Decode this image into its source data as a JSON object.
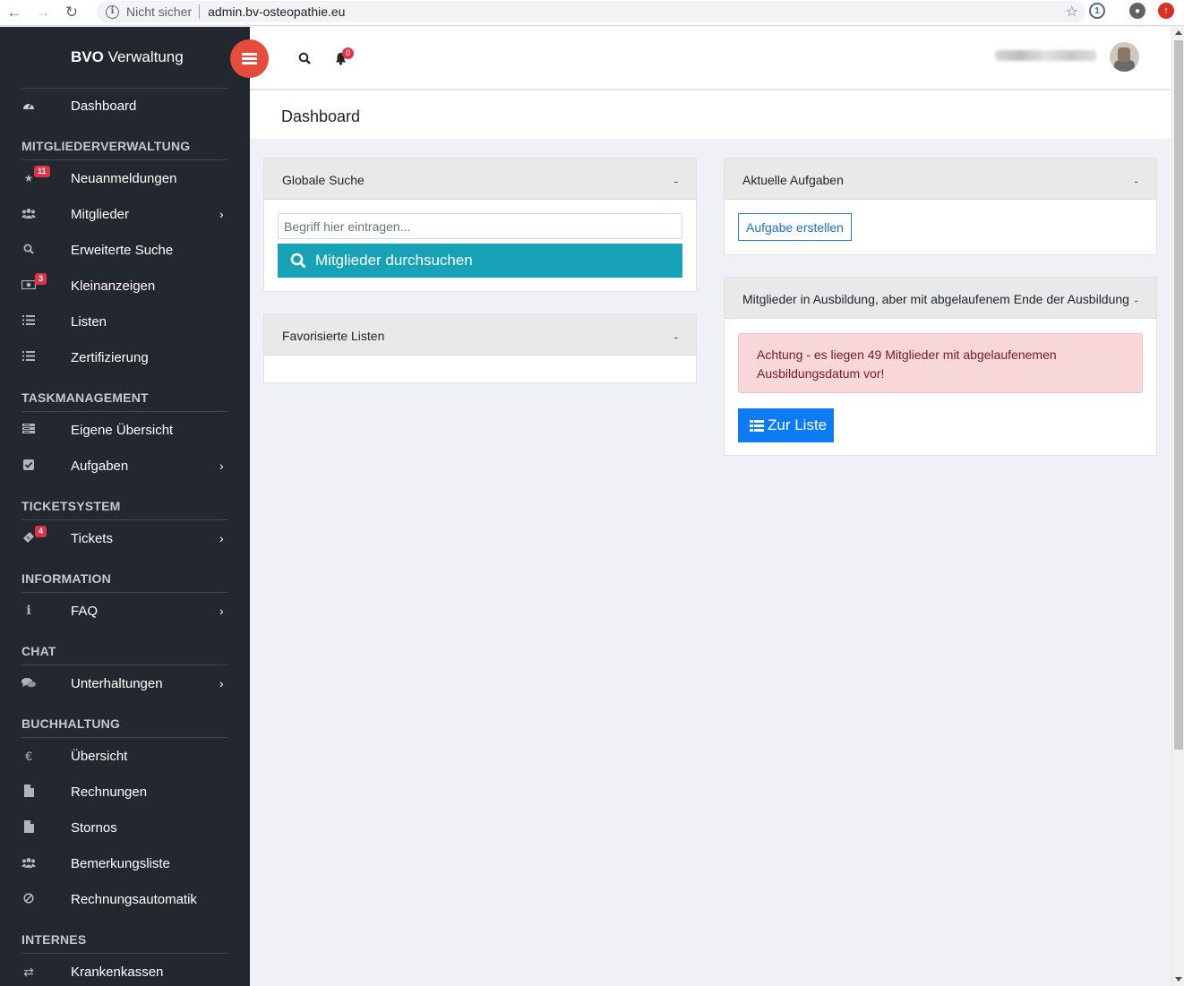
{
  "browser": {
    "security_label": "Nicht sicher",
    "url": "admin.bv-osteopathie.eu"
  },
  "brand": {
    "bold": "BVO",
    "rest": "Verwaltung"
  },
  "header": {
    "notification_count": "0"
  },
  "page": {
    "title": "Dashboard"
  },
  "sidebar": {
    "dashboard": "Dashboard",
    "sections": [
      {
        "title": "MITGLIEDERVERWALTUNG",
        "items": [
          {
            "label": "Neuanmeldungen",
            "badge": "11"
          },
          {
            "label": "Mitglieder"
          },
          {
            "label": "Erweiterte Suche"
          },
          {
            "label": "Kleinanzeigen",
            "badge": "3"
          },
          {
            "label": "Listen"
          },
          {
            "label": "Zertifizierung"
          }
        ]
      },
      {
        "title": "TASKMANAGEMENT",
        "items": [
          {
            "label": "Eigene Übersicht"
          },
          {
            "label": "Aufgaben"
          }
        ]
      },
      {
        "title": "TICKETSYSTEM",
        "items": [
          {
            "label": "Tickets",
            "badge": "4"
          }
        ]
      },
      {
        "title": "INFORMATION",
        "items": [
          {
            "label": "FAQ"
          }
        ]
      },
      {
        "title": "CHAT",
        "items": [
          {
            "label": "Unterhaltungen"
          }
        ]
      },
      {
        "title": "BUCHHALTUNG",
        "items": [
          {
            "label": "Übersicht",
            "icon_glyph": "€"
          },
          {
            "label": "Rechnungen"
          },
          {
            "label": "Stornos"
          },
          {
            "label": "Bemerkungsliste"
          },
          {
            "label": "Rechnungsautomatik"
          }
        ]
      },
      {
        "title": "INTERNES",
        "items": [
          {
            "label": "Krankenkassen"
          }
        ]
      }
    ]
  },
  "cards": {
    "global_search": {
      "title": "Globale Suche",
      "collapse": "-",
      "placeholder": "Begriff hier eintragen...",
      "button": "Mitglieder durchsuchen"
    },
    "favorite_lists": {
      "title": "Favorisierte Listen",
      "collapse": "-"
    },
    "current_tasks": {
      "title": "Aktuelle Aufgaben",
      "collapse": "-",
      "button": "Aufgabe erstellen"
    },
    "training": {
      "title": "Mitglieder in Ausbildung, aber mit abgelaufenem Ende der Ausbildung",
      "collapse": "-",
      "alert": "Achtung - es liegen 49 Mitglieder mit abgelaufenemen Ausbildungsdatum vor!",
      "button": "Zur Liste"
    }
  },
  "colors": {
    "sidebar": "#23272f",
    "toggle": "#e64c3c",
    "search_button": "#17a2b8",
    "primary": "#0d7bf5",
    "badge": "#dc3545"
  }
}
